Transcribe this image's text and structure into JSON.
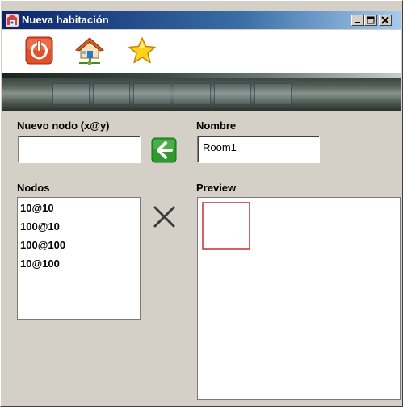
{
  "window": {
    "title": "Nueva habitación"
  },
  "toolbar": {
    "items": [
      {
        "icon": "power-icon"
      },
      {
        "icon": "house-network-icon"
      },
      {
        "icon": "star-icon"
      }
    ]
  },
  "form": {
    "new_node_label": "Nuevo nodo (x@y)",
    "new_node_value": "",
    "name_label": "Nombre",
    "name_value": "Room1",
    "nodes_label": "Nodos",
    "preview_label": "Preview"
  },
  "nodes": [
    "10@10",
    "100@10",
    "100@100",
    "10@100"
  ],
  "preview": {
    "shape_color": "#c03030"
  },
  "colors": {
    "titlebar_start": "#0a246a",
    "titlebar_end": "#a6caf0",
    "window_bg": "#d4d0c8",
    "arrow_green": "#2e9b2e"
  }
}
